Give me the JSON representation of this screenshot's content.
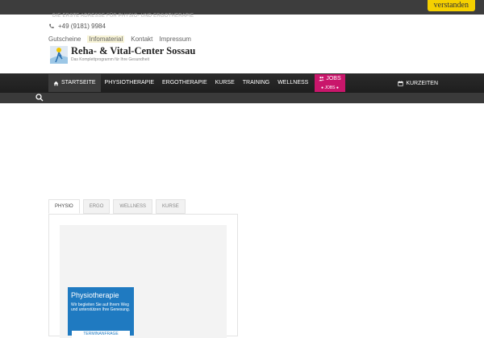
{
  "cookie": {
    "button_label": "verstanden"
  },
  "header": {
    "tagline": "DIE ERSTE ADRESSE FÜR PHYSIO- UND ERGOTHERAPIE",
    "phone": "+49 (9181) 9984",
    "links": [
      "Gutscheine",
      "Infomaterial",
      "Kontakt",
      "Impressum"
    ],
    "logo_title": "Reha- & Vital-Center Sossau",
    "logo_subtitle": "Das Komplettprogramm für Ihre Gesundheit"
  },
  "nav": {
    "items": [
      "STARTSEITE",
      "PHYSIOTHERAPIE",
      "ERGOTHERAPIE",
      "KURSE",
      "TRAINING",
      "WELLNESS"
    ],
    "jobs_label": "JOBS",
    "jobs_sub": "JOBS",
    "right_label": "KURZEITEN"
  },
  "tabs": [
    "PHYSIO",
    "ERGO",
    "WELLNESS",
    "KURSE"
  ],
  "card": {
    "title": "Physiotherapie",
    "text": "Wir begleiten Sie auf Ihrem Weg und unterstützen Ihre Genesung.",
    "button": "TERMINANFRAGE"
  },
  "colors": {
    "accent_blue": "#1f7ac1",
    "jobs_pink": "#c9166b",
    "cookie_yellow": "#f5d000"
  }
}
